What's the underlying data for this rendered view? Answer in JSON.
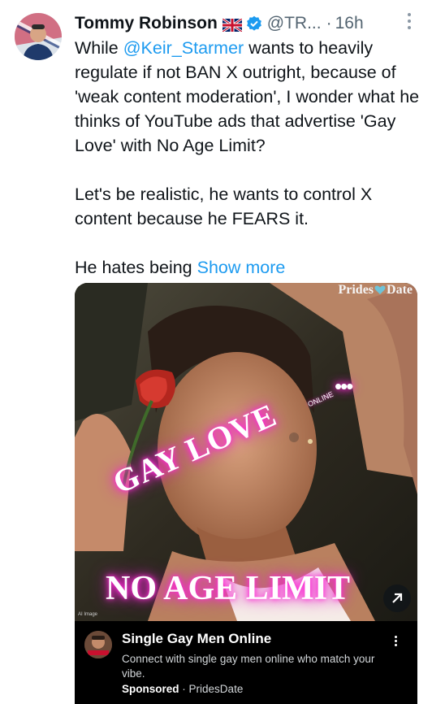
{
  "tweet": {
    "author_name": "Tommy Robinson",
    "handle": "@TR...",
    "separator": "·",
    "time": "16h",
    "text_before_mention": "While ",
    "mention": "@Keir_Starmer",
    "text_after_mention": " wants to heavily regulate if not BAN X outright, because of 'weak content moderation', I wonder what he thinks of YouTube ads that advertise 'Gay Love' with No Age Limit?\n\nLet's be realistic, he wants to control X content because he FEARS it.\n\nHe hates being ",
    "show_more": "Show more"
  },
  "ad": {
    "brand_left": "Prides",
    "brand_right": "Date",
    "overlay_line1": "GAY LOVE",
    "overlay_tag": "ONLINE",
    "overlay_dots": "•••",
    "overlay_line2": "NO AGE LIMIT",
    "ai_label": "AI Image",
    "title": "Single Gay Men Online",
    "description": "Connect with single gay men online who match your vibe.",
    "sponsored": "Sponsored",
    "meta_separator": "·",
    "advertiser": "PridesDate"
  },
  "icons": {
    "flag": "uk-flag-icon",
    "verified": "verified-badge-icon",
    "more": "more-options-icon",
    "expand": "external-link-arrow-icon",
    "brand_heart": "heart-logo-icon"
  },
  "colors": {
    "link": "#1d9bf0",
    "verified": "#1d9bf0",
    "neon": "#ff2bd6",
    "secondary_text": "#536471"
  }
}
